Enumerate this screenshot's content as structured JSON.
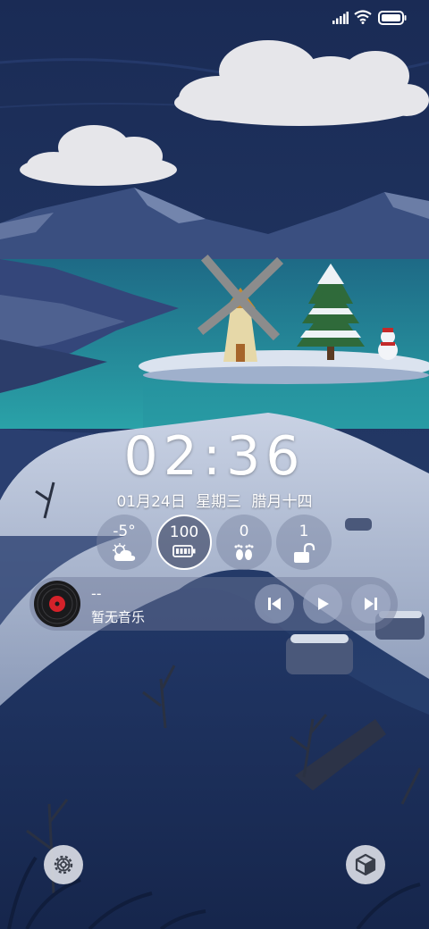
{
  "status_bar": {
    "signal_icon": "signal-bars-icon",
    "wifi_icon": "wifi-icon",
    "battery_icon": "battery-full-icon"
  },
  "clock": {
    "time": "02:36"
  },
  "date": {
    "date": "01月24日",
    "weekday": "星期三",
    "lunar": "腊月十四"
  },
  "widgets": {
    "weather": {
      "value": "-5°",
      "icon": "cloudy-weather-icon"
    },
    "battery": {
      "value": "100",
      "icon": "battery-icon"
    },
    "steps": {
      "value": "0",
      "icon": "footprints-icon"
    },
    "unlock": {
      "value": "1",
      "icon": "unlocked-padlock-icon"
    }
  },
  "music": {
    "title": "--",
    "subtitle": "暂无音乐",
    "cover_icon": "vinyl-record-icon",
    "prev_icon": "skip-previous-icon",
    "play_icon": "play-icon",
    "next_icon": "skip-next-icon"
  },
  "shortcuts": {
    "left_icon": "settings-gear-icon",
    "right_icon": "cube-3d-icon"
  },
  "colors": {
    "sky": "#1d3160",
    "lake": "#2a8a9e",
    "snow": "#d8e0ee",
    "widget_bg": "#7882a0",
    "vinyl_red": "#d5222a"
  }
}
